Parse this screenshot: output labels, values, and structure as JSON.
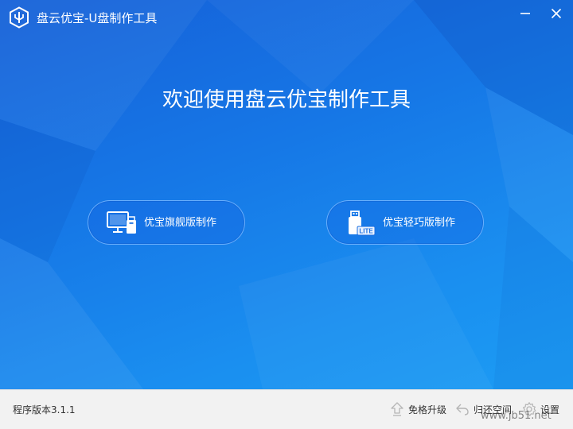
{
  "window": {
    "title": "盘云优宝-U盘制作工具",
    "logo_icon": "usb-shield-logo",
    "minimize_icon": "minimize-icon",
    "close_icon": "close-icon"
  },
  "main": {
    "welcome_text": "欢迎使用盘云优宝制作工具",
    "background_color": "#1677e6",
    "options": [
      {
        "label": "优宝旗舰版制作",
        "icon": "monitor-usb-icon"
      },
      {
        "label": "优宝轻巧版制作",
        "icon": "usb-lite-icon",
        "badge": "LITE"
      }
    ]
  },
  "footer": {
    "version_text": "程序版本3.1.1",
    "upgrade_label": "免格升级",
    "restore_label": "归还空间",
    "settings_label": "设置"
  },
  "watermark": "www.jb51.net"
}
